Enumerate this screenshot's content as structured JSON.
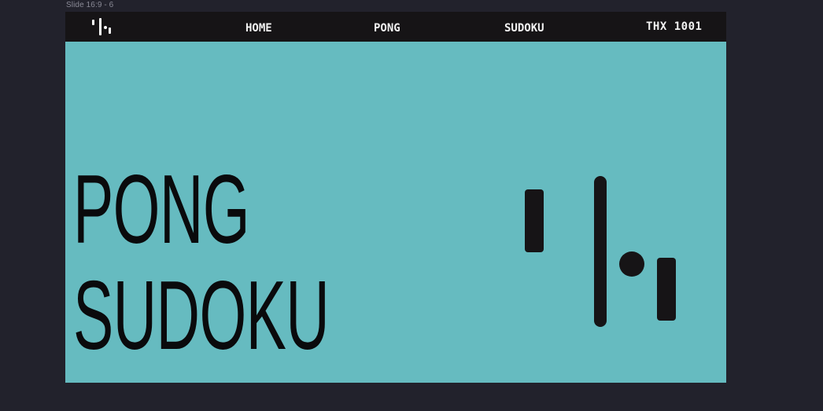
{
  "canvas": {
    "frame_label": "Slide 16:9 - 6",
    "background_color": "#22222c",
    "slide_color": "#66bbc0"
  },
  "nav": {
    "logo_icon": "pong-logo-icon",
    "items": [
      {
        "label": "HOME"
      },
      {
        "label": "PONG"
      },
      {
        "label": "SUDOKU"
      },
      {
        "label": "THX 1001"
      }
    ],
    "background_color": "#161416",
    "text_color": "#f2f2f2"
  },
  "hero": {
    "line1": "PONG",
    "line2": "SUDOKU",
    "text_color": "#0a0a0c"
  },
  "illustration": {
    "icon": "pong-game-illustration",
    "color": "#161416"
  }
}
